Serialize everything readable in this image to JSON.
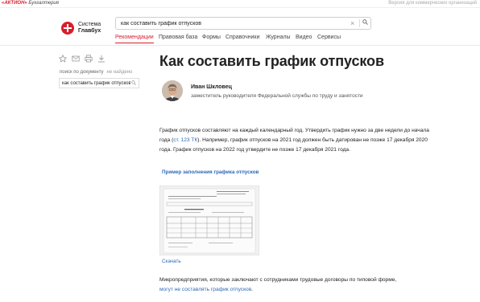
{
  "topbar": {
    "brand_action": "«АКТИОН»",
    "brand_product": "Бухгалтерия",
    "right_text": "Версия для коммерческих организаций"
  },
  "logo": {
    "line1": "Система",
    "line2": "Главбух"
  },
  "search": {
    "value": "как составить график отпусков"
  },
  "nav": [
    "Рекомендации",
    "Правовая база",
    "Формы",
    "Справочники",
    "Журналы",
    "Видео",
    "Сервисы"
  ],
  "sidebar": {
    "search_label": "поиск по документу",
    "not_found": "не найдено",
    "search_value": "как составить график отпусков"
  },
  "article": {
    "title": "Как составить график отпусков",
    "author_name": "Иван Шкловец",
    "author_role": "заместитель руководителя Федеральной службы по труду и занятости",
    "p1_a": "График отпусков составляют на каждый календарный год. Утвердить график нужно за две недели до начала года (",
    "p1_link": "ст. 123 ТК",
    "p1_b": "). Например, график отпусков на 2021 год должен быть датирован не позже 17 декабря 2020 года. График отпусков на 2022 год утвердите не позже 17 декабря 2021 года.",
    "sample_link": "Пример заполнения графика отпусков",
    "download_link": "Скачать",
    "p2_a": "Микропредприятия, которые заключают с сотрудниками трудовые договоры по типовой форме,",
    "p2_link": "могут не составлять график отпусков",
    "p2_b": "."
  },
  "colors": {
    "brand_red": "#d81e2c",
    "link_blue": "#2c68b8"
  }
}
